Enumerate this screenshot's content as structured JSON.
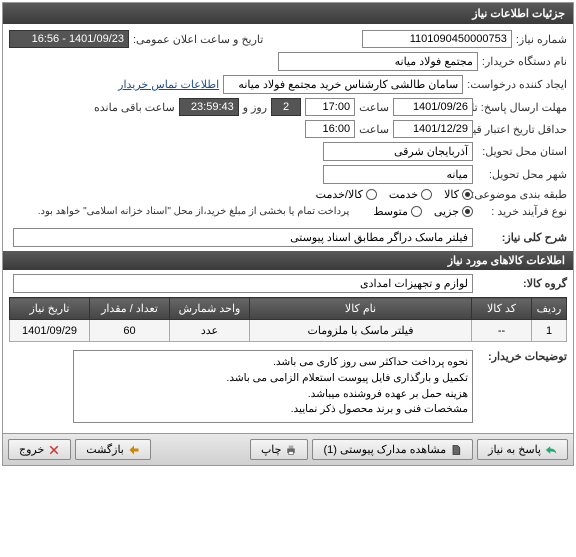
{
  "header": {
    "title": "جزئیات اطلاعات نیاز"
  },
  "info": {
    "request_number_label": "شماره نیاز:",
    "request_number": "1101090450000753",
    "announce_label": "تاریخ و ساعت اعلان عمومی:",
    "announce_value": "1401/09/23 - 16:56",
    "buyer_label": "نام دستگاه خریدار:",
    "buyer_value": "مجتمع فولاد میانه",
    "creator_label": "ایجاد کننده درخواست:",
    "creator_value": "سامان طالشی کارشناس خرید مجتمع فولاد میانه",
    "contact_link": "اطلاعات تماس خریدار",
    "deadline_label": "مهلت ارسال پاسخ: تا تاریخ:",
    "deadline_date": "1401/09/26",
    "hour_label": "ساعت",
    "deadline_time": "17:00",
    "day_and": "روز و",
    "remaining_days": "2",
    "remaining_time": "23:59:43",
    "remaining_suffix": "ساعت باقی مانده",
    "validity_label": "حداقل تاریخ اعتبار قیمت: تا تاریخ:",
    "validity_date": "1401/12/29",
    "validity_time": "16:00",
    "province_label": "استان محل تحویل:",
    "province_value": "آذربایجان شرقی",
    "city_label": "شهر محل تحویل:",
    "city_value": "میانه",
    "category_label": "طبقه بندی موضوعی:",
    "cat_goods": "کالا",
    "cat_service": "خدمت",
    "cat_both": "کالا/خدمت",
    "process_label": "نوع فرآیند خرید :",
    "proc_minor": "جزیی",
    "proc_medium": "متوسط",
    "payment_note": "پرداخت تمام یا بخشی از مبلغ خرید،از محل \"اسناد خزانه اسلامی\" خواهد بود."
  },
  "desc": {
    "label": "شرح کلی نیاز:",
    "value": "فیلتر ماسک دراگر مطابق اسناد پیوستی"
  },
  "goods": {
    "header": "اطلاعات کالاهای مورد نیاز",
    "group_label": "گروه کالا:",
    "group_value": "لوازم و تجهیزات امدادی",
    "columns": {
      "row": "ردیف",
      "code": "کد کالا",
      "name": "نام کالا",
      "unit": "واحد شمارش",
      "qty": "تعداد / مقدار",
      "date": "تاریخ نیاز"
    },
    "rows": [
      {
        "row": "1",
        "code": "--",
        "name": "فیلتر ماسک با ملزومات",
        "unit": "عدد",
        "qty": "60",
        "date": "1401/09/29"
      }
    ]
  },
  "buyer_notes": {
    "label": "توضیحات خریدار:",
    "lines": [
      "نحوه پرداخت حداکثر سی روز کاری می باشد.",
      "تکمیل و بارگذاری فایل پیوست استعلام الزامی می باشد.",
      "هزینه حمل بر عهده فروشنده میباشد.",
      "مشخصات فنی و برند محصول ذکر نمایید."
    ]
  },
  "buttons": {
    "respond": "پاسخ به نیاز",
    "attachments": "مشاهده مدارک پیوستی (1)",
    "print": "چاپ",
    "back": "بازگشت",
    "exit": "خروج"
  }
}
